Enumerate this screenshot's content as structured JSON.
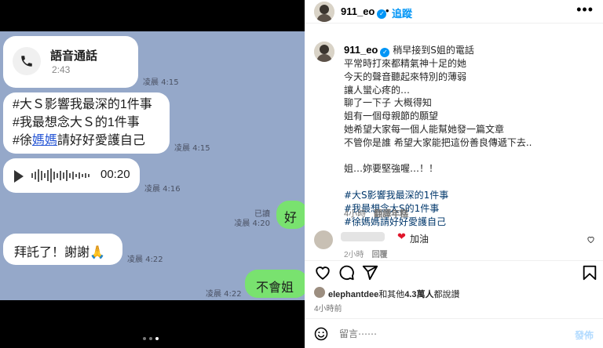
{
  "media": {
    "call": {
      "title": "語音通話",
      "duration": "2:43",
      "time": "凌晨 4:15"
    },
    "hashtags": {
      "line1": "#大Ｓ影響我最深的1件事",
      "line2": "#我最想念大Ｓ的1件事",
      "line3_pre": "#徐",
      "line3_link": "媽媽",
      "line3_post": "請好好愛護自己",
      "time": "凌晨 4:15"
    },
    "voice": {
      "duration": "00:20",
      "time": "凌晨 4:16"
    },
    "ok": {
      "text": "好",
      "read": "已讀",
      "time": "凌晨 4:20"
    },
    "thanks": {
      "text": "拜託了！謝謝🙏",
      "time": "凌晨 4:22"
    },
    "no": {
      "text": "不會姐",
      "time": "凌晨 4:22"
    },
    "carousel": {
      "count": 3,
      "active": 3
    }
  },
  "header": {
    "username": "911_eo",
    "dot": "•",
    "follow": "追蹤",
    "more": "•••"
  },
  "caption": {
    "username": "911_eo",
    "first_line": "稍早接到S姐的電話",
    "lines": [
      "平常時打來都精氣神十足的她",
      "今天的聲音聽起來特別的薄弱",
      "讓人蠻心疼的…",
      "聊了一下子 大概得知",
      "姐有一個母親節的願望",
      "她希望大家每一個人能幫她發一篇文章",
      "不管你是誰 希望大家能把這份善良傳遞下去.."
    ],
    "closing": "姐…妳要堅強喔…！！",
    "tags": [
      "#大S影響我最深的1件事",
      "#我最想念大S的1件事",
      "#徐媽媽請好好愛護自己"
    ],
    "time": "4小時",
    "translate": "翻譯年糕"
  },
  "comment": {
    "heart": "❤",
    "text": "加油",
    "time": "2小時",
    "reply": "回覆"
  },
  "likes": {
    "user": "elephantdee",
    "and_others": "和其他",
    "count": "4.3萬人",
    "suffix": "都說讚"
  },
  "posted": "4小時前",
  "comment_bar": {
    "placeholder": "留言⋯⋯",
    "post": "發佈"
  },
  "colors": {
    "chat_bg": "#95a8c9",
    "green_bubble": "#79e26f",
    "link_blue": "#0095f6",
    "tag_blue": "#00376b",
    "heart_red": "#e0162b"
  }
}
